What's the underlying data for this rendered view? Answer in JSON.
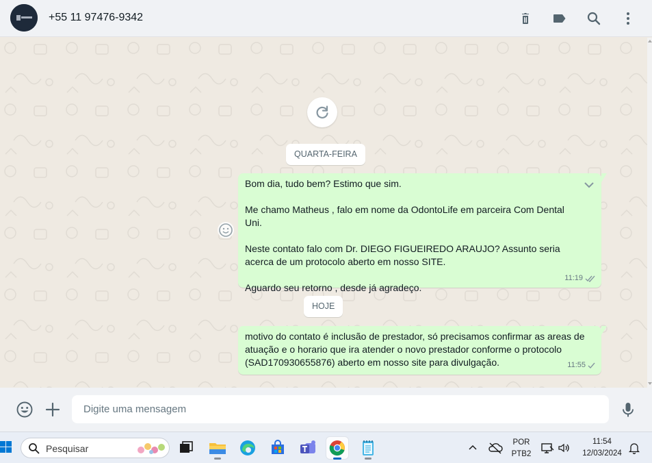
{
  "header": {
    "contact_name": "+55 11 97476-9342",
    "icons": [
      "delete-icon",
      "label-icon",
      "search-icon",
      "menu-icon"
    ]
  },
  "chat": {
    "day_chips": [
      "QUARTA-FEIRA",
      "HOJE"
    ],
    "messages": [
      {
        "text": "Bom dia, tudo bem? Estimo que sim.\n\nMe chamo Matheus , falo em nome da OdontoLife em parceira Com Dental Uni.\n\nNeste contato falo com Dr. DIEGO FIGUEIREDO ARAUJO? Assunto seria acerca de um protocolo aberto em nosso SITE.\n\nAguardo seu retorno , desde já agradeço.",
        "time": "11:19",
        "status": "delivered"
      },
      {
        "text": "motivo do contato é inclusão de prestador, só precisamos confirmar as areas de atuação e o horario que ira atender o novo prestador conforme o protocolo (SAD170930655876) aberto em nosso site para divulgação.",
        "time": "11:55",
        "status": "sent"
      }
    ]
  },
  "composer": {
    "placeholder": "Digite uma mensagem"
  },
  "taskbar": {
    "search_placeholder": "Pesquisar",
    "language": "POR",
    "layout": "PTB2",
    "time": "11:54",
    "date": "12/03/2024"
  },
  "colors": {
    "outgoing_bubble": "#d9fdd3",
    "chat_background": "#efeae2",
    "header_background": "#f0f2f5",
    "read_tick": "#8696a0"
  }
}
